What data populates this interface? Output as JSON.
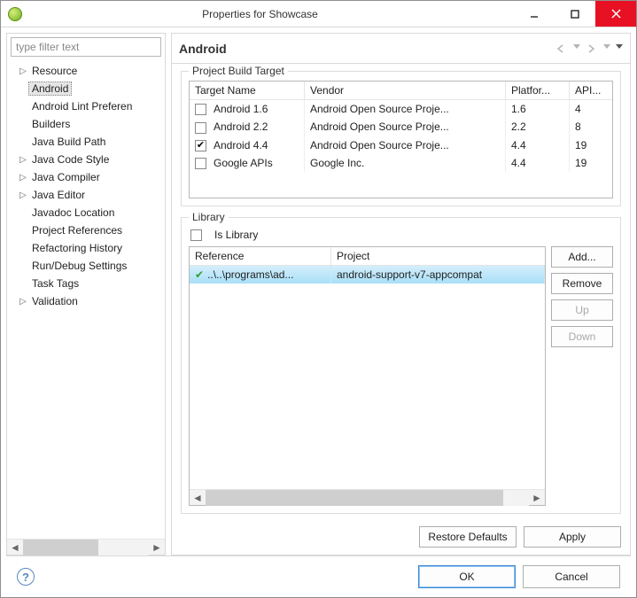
{
  "titlebar": {
    "title": "Properties for Showcase"
  },
  "left": {
    "filter_placeholder": "type filter text",
    "items": [
      {
        "label": "Resource",
        "expandable": true
      },
      {
        "label": "Android",
        "selected": true
      },
      {
        "label": "Android Lint Preferen"
      },
      {
        "label": "Builders"
      },
      {
        "label": "Java Build Path"
      },
      {
        "label": "Java Code Style",
        "expandable": true
      },
      {
        "label": "Java Compiler",
        "expandable": true
      },
      {
        "label": "Java Editor",
        "expandable": true
      },
      {
        "label": "Javadoc Location"
      },
      {
        "label": "Project References"
      },
      {
        "label": "Refactoring History"
      },
      {
        "label": "Run/Debug Settings"
      },
      {
        "label": "Task Tags"
      },
      {
        "label": "Validation",
        "expandable": true
      }
    ]
  },
  "right": {
    "heading": "Android",
    "build_target": {
      "legend": "Project Build Target",
      "columns": {
        "target": "Target Name",
        "vendor": "Vendor",
        "platform": "Platfor...",
        "api": "API..."
      },
      "rows": [
        {
          "checked": false,
          "target": "Android 1.6",
          "vendor": "Android Open Source Proje...",
          "platform": "1.6",
          "api": "4"
        },
        {
          "checked": false,
          "target": "Android 2.2",
          "vendor": "Android Open Source Proje...",
          "platform": "2.2",
          "api": "8"
        },
        {
          "checked": true,
          "target": "Android 4.4",
          "vendor": "Android Open Source Proje...",
          "platform": "4.4",
          "api": "19"
        },
        {
          "checked": false,
          "target": "Google APIs",
          "vendor": "Google Inc.",
          "platform": "4.4",
          "api": "19"
        }
      ]
    },
    "library": {
      "legend": "Library",
      "is_library_label": "Is Library",
      "is_library_checked": false,
      "columns": {
        "reference": "Reference",
        "project": "Project"
      },
      "rows": [
        {
          "reference": "..\\..\\programs\\ad...",
          "project": "android-support-v7-appcompat"
        }
      ],
      "buttons": {
        "add": "Add...",
        "remove": "Remove",
        "up": "Up",
        "down": "Down"
      }
    },
    "actions": {
      "restore": "Restore Defaults",
      "apply": "Apply"
    }
  },
  "footer": {
    "ok": "OK",
    "cancel": "Cancel"
  }
}
